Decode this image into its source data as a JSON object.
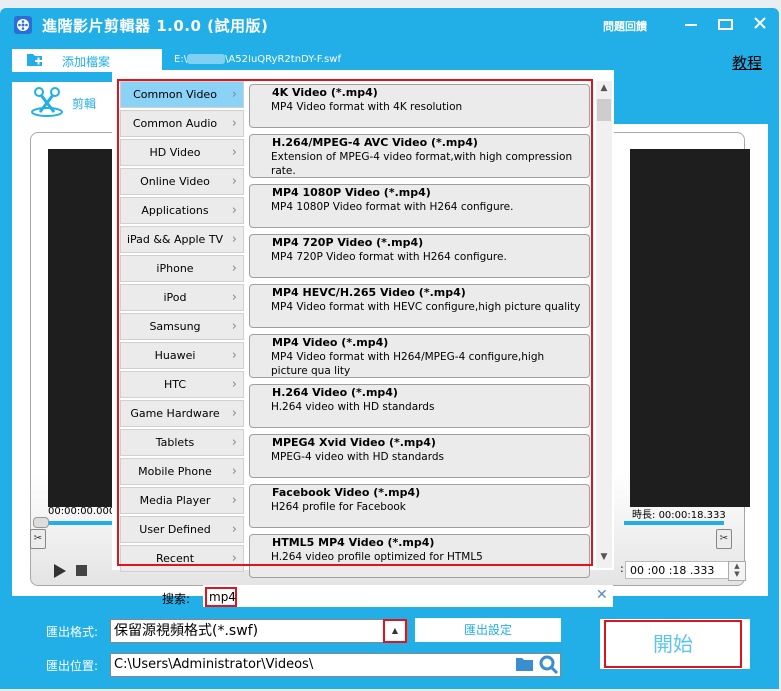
{
  "window": {
    "title": "進階影片剪輯器 1.0.0 (試用版)",
    "feedback_label": "問題回饋",
    "controls": [
      "minimize",
      "maximize",
      "close"
    ]
  },
  "toolbar": {
    "add_file_label": "添加檔案",
    "file_path_prefix": "E:\\",
    "file_path_suffix": "\\A52IuQRyR2tnDY-F.swf",
    "tutorial_link": "教程"
  },
  "tabs": [
    {
      "label": "剪輯",
      "icon": "scissors-film-icon",
      "active": true
    }
  ],
  "player": {
    "start_time": "00:00:00.000",
    "duration_label": "時長:",
    "duration": "00:00:18.333",
    "end_time_spin": "00 :00 :18 .333",
    "start_position_fraction": 0,
    "end_position_fraction": 1
  },
  "format_popup": {
    "categories": [
      {
        "label": "Common Video",
        "active": true
      },
      {
        "label": "Common Audio"
      },
      {
        "label": "HD Video"
      },
      {
        "label": "Online Video"
      },
      {
        "label": "Applications"
      },
      {
        "label": "iPad && Apple TV"
      },
      {
        "label": "iPhone"
      },
      {
        "label": "iPod"
      },
      {
        "label": "Samsung"
      },
      {
        "label": "Huawei"
      },
      {
        "label": "HTC"
      },
      {
        "label": "Game Hardware"
      },
      {
        "label": "Tablets"
      },
      {
        "label": "Mobile Phone"
      },
      {
        "label": "Media Player"
      },
      {
        "label": "User Defined"
      },
      {
        "label": "Recent"
      }
    ],
    "formats": [
      {
        "title": "4K Video (*.mp4)",
        "desc": "MP4 Video format with 4K resolution"
      },
      {
        "title": "H.264/MPEG-4 AVC Video (*.mp4)",
        "desc": "Extension of MPEG-4 video format,with high compression rate."
      },
      {
        "title": "MP4 1080P Video (*.mp4)",
        "desc": "MP4 1080P Video format with H264 configure."
      },
      {
        "title": "MP4 720P Video (*.mp4)",
        "desc": "MP4 720P Video format with H264 configure."
      },
      {
        "title": "MP4 HEVC/H.265 Video (*.mp4)",
        "desc": "MP4 Video format with HEVC configure,high picture quality"
      },
      {
        "title": "MP4 Video (*.mp4)",
        "desc": "MP4 Video format with H264/MPEG-4 configure,high picture qua lity"
      },
      {
        "title": "H.264 Video (*.mp4)",
        "desc": "H.264 video with HD standards"
      },
      {
        "title": "MPEG4 Xvid Video (*.mp4)",
        "desc": "MPEG-4 video with HD standards"
      },
      {
        "title": "Facebook Video (*.mp4)",
        "desc": "H264 profile for Facebook"
      },
      {
        "title": "HTML5 MP4 Video (*.mp4)",
        "desc": "H.264 video profile optimized for HTML5"
      }
    ],
    "search_label": "搜索:",
    "search_value": "mp4"
  },
  "export": {
    "format_label": "匯出格式:",
    "format_value": "保留源視頻格式(*.swf)",
    "settings_button": "匯出設定",
    "location_label": "匯出位置:",
    "location_value": "C:\\Users\\Administrator\\Videos\\",
    "start_button": "開始"
  },
  "colors": {
    "accent": "#22afe8",
    "highlight_red": "#e0141e",
    "active_category": "#8ad2f6"
  }
}
